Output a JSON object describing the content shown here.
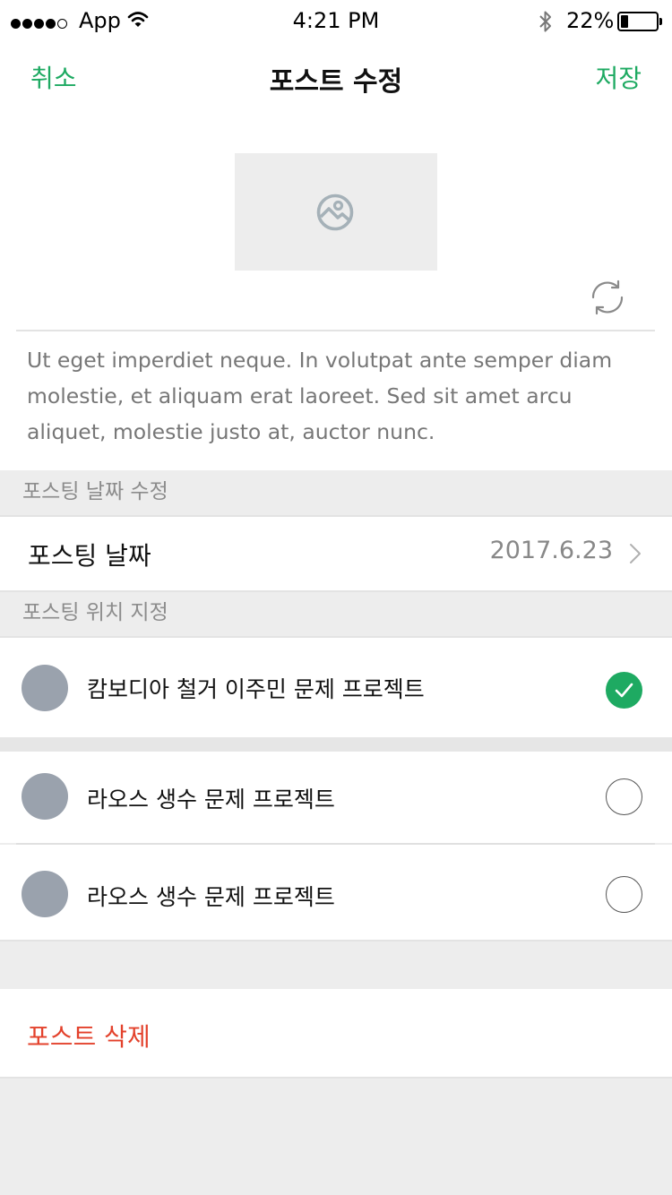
{
  "status_bar": {
    "carrier": "App",
    "time": "4:21 PM",
    "battery": "22%",
    "battery_level": 0.22
  },
  "nav": {
    "cancel_label": "취소",
    "title": "포스트 수정",
    "save_label": "저장"
  },
  "post": {
    "body_text": "Ut eget imperdiet neque. In volutpat ante semper diam molestie, et aliquam erat laoreet. Sed sit amet arcu aliquet, molestie justo at, auctor nunc."
  },
  "date_section": {
    "header": "포스팅 날짜 수정",
    "row_label": "포스팅 날짜",
    "row_value": "2017.6.23"
  },
  "location_section": {
    "header": "포스팅 위치 지정",
    "items": [
      {
        "label": "캄보디아 철거 이주민 문제 프로젝트",
        "selected": true
      },
      {
        "label": "라오스 생수 문제 프로젝트",
        "selected": false
      },
      {
        "label": "라오스 생수 문제 프로젝트",
        "selected": false
      }
    ]
  },
  "delete_label": "포스트 삭제",
  "icons": {
    "image_placeholder": "image-icon",
    "refresh": "refresh-icon",
    "chevron": "chevron-right-icon",
    "check": "check-icon"
  },
  "colors": {
    "accent": "#1eaa62",
    "danger": "#e3412b",
    "avatar": "#9aa2ad",
    "background": "#ededed"
  }
}
